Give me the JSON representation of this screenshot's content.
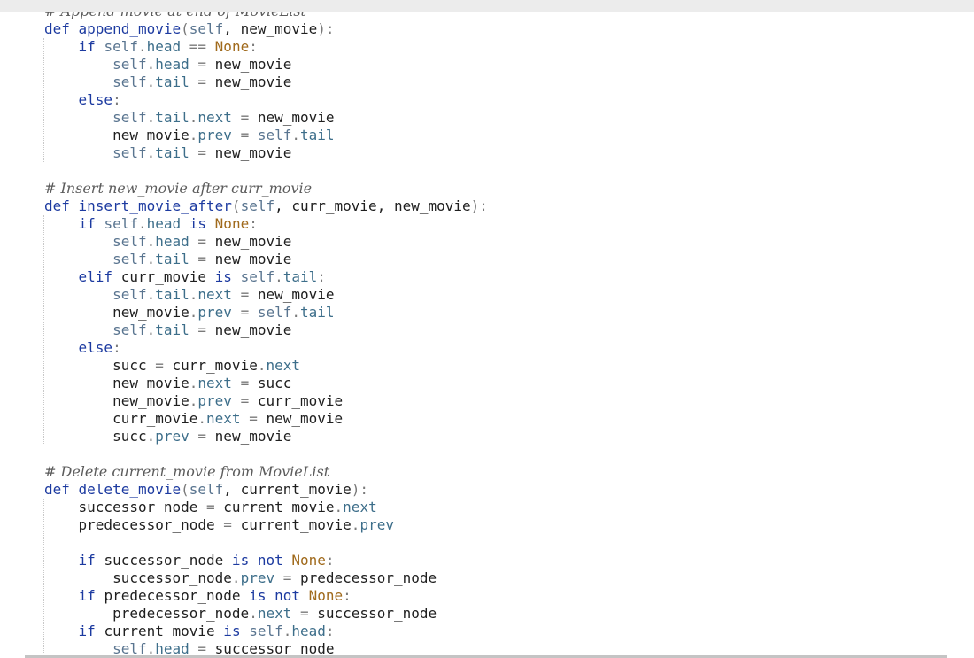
{
  "editor": {
    "lines": [
      [
        {
          "t": "# Append movie at end of MovieList",
          "c": "cm"
        }
      ],
      [
        {
          "t": "def ",
          "c": "kw"
        },
        {
          "t": "append_movie",
          "c": "kw"
        },
        {
          "t": "(",
          "c": "op"
        },
        {
          "t": "self",
          "c": "sf"
        },
        {
          "t": ", new_movie",
          "c": ""
        },
        {
          "t": "):",
          "c": "op"
        }
      ],
      [
        {
          "t": "    "
        },
        {
          "t": "if ",
          "c": "kw"
        },
        {
          "t": "self",
          "c": "sf"
        },
        {
          "t": ".",
          "c": "op"
        },
        {
          "t": "head",
          "c": "at"
        },
        {
          "t": " == ",
          "c": "op"
        },
        {
          "t": "None",
          "c": "bi"
        },
        {
          "t": ":",
          "c": "op"
        }
      ],
      [
        {
          "t": "        "
        },
        {
          "t": "self",
          "c": "sf"
        },
        {
          "t": ".",
          "c": "op"
        },
        {
          "t": "head",
          "c": "at"
        },
        {
          "t": " = ",
          "c": "op"
        },
        {
          "t": "new_movie"
        }
      ],
      [
        {
          "t": "        "
        },
        {
          "t": "self",
          "c": "sf"
        },
        {
          "t": ".",
          "c": "op"
        },
        {
          "t": "tail",
          "c": "at"
        },
        {
          "t": " = ",
          "c": "op"
        },
        {
          "t": "new_movie"
        }
      ],
      [
        {
          "t": "    "
        },
        {
          "t": "else",
          "c": "kw"
        },
        {
          "t": ":",
          "c": "op"
        }
      ],
      [
        {
          "t": "        "
        },
        {
          "t": "self",
          "c": "sf"
        },
        {
          "t": ".",
          "c": "op"
        },
        {
          "t": "tail",
          "c": "at"
        },
        {
          "t": ".",
          "c": "op"
        },
        {
          "t": "next",
          "c": "at"
        },
        {
          "t": " = ",
          "c": "op"
        },
        {
          "t": "new_movie"
        }
      ],
      [
        {
          "t": "        "
        },
        {
          "t": "new_movie"
        },
        {
          "t": ".",
          "c": "op"
        },
        {
          "t": "prev",
          "c": "at"
        },
        {
          "t": " = ",
          "c": "op"
        },
        {
          "t": "self",
          "c": "sf"
        },
        {
          "t": ".",
          "c": "op"
        },
        {
          "t": "tail",
          "c": "at"
        }
      ],
      [
        {
          "t": "        "
        },
        {
          "t": "self",
          "c": "sf"
        },
        {
          "t": ".",
          "c": "op"
        },
        {
          "t": "tail",
          "c": "at"
        },
        {
          "t": " = ",
          "c": "op"
        },
        {
          "t": "new_movie"
        }
      ],
      [],
      [
        {
          "t": "# Insert new_movie after curr_movie",
          "c": "cm"
        }
      ],
      [
        {
          "t": "def ",
          "c": "kw"
        },
        {
          "t": "insert_movie_after",
          "c": "kw"
        },
        {
          "t": "(",
          "c": "op"
        },
        {
          "t": "self",
          "c": "sf"
        },
        {
          "t": ", curr_movie, new_movie"
        },
        {
          "t": "):",
          "c": "op"
        }
      ],
      [
        {
          "t": "    "
        },
        {
          "t": "if ",
          "c": "kw"
        },
        {
          "t": "self",
          "c": "sf"
        },
        {
          "t": ".",
          "c": "op"
        },
        {
          "t": "head",
          "c": "at"
        },
        {
          "t": " is ",
          "c": "kw"
        },
        {
          "t": "None",
          "c": "bi"
        },
        {
          "t": ":",
          "c": "op"
        }
      ],
      [
        {
          "t": "        "
        },
        {
          "t": "self",
          "c": "sf"
        },
        {
          "t": ".",
          "c": "op"
        },
        {
          "t": "head",
          "c": "at"
        },
        {
          "t": " = ",
          "c": "op"
        },
        {
          "t": "new_movie"
        }
      ],
      [
        {
          "t": "        "
        },
        {
          "t": "self",
          "c": "sf"
        },
        {
          "t": ".",
          "c": "op"
        },
        {
          "t": "tail",
          "c": "at"
        },
        {
          "t": " = ",
          "c": "op"
        },
        {
          "t": "new_movie"
        }
      ],
      [
        {
          "t": "    "
        },
        {
          "t": "elif ",
          "c": "kw"
        },
        {
          "t": "curr_movie"
        },
        {
          "t": " is ",
          "c": "kw"
        },
        {
          "t": "self",
          "c": "sf"
        },
        {
          "t": ".",
          "c": "op"
        },
        {
          "t": "tail",
          "c": "at"
        },
        {
          "t": ":",
          "c": "op"
        }
      ],
      [
        {
          "t": "        "
        },
        {
          "t": "self",
          "c": "sf"
        },
        {
          "t": ".",
          "c": "op"
        },
        {
          "t": "tail",
          "c": "at"
        },
        {
          "t": ".",
          "c": "op"
        },
        {
          "t": "next",
          "c": "at"
        },
        {
          "t": " = ",
          "c": "op"
        },
        {
          "t": "new_movie"
        }
      ],
      [
        {
          "t": "        "
        },
        {
          "t": "new_movie"
        },
        {
          "t": ".",
          "c": "op"
        },
        {
          "t": "prev",
          "c": "at"
        },
        {
          "t": " = ",
          "c": "op"
        },
        {
          "t": "self",
          "c": "sf"
        },
        {
          "t": ".",
          "c": "op"
        },
        {
          "t": "tail",
          "c": "at"
        }
      ],
      [
        {
          "t": "        "
        },
        {
          "t": "self",
          "c": "sf"
        },
        {
          "t": ".",
          "c": "op"
        },
        {
          "t": "tail",
          "c": "at"
        },
        {
          "t": " = ",
          "c": "op"
        },
        {
          "t": "new_movie"
        }
      ],
      [
        {
          "t": "    "
        },
        {
          "t": "else",
          "c": "kw"
        },
        {
          "t": ":",
          "c": "op"
        }
      ],
      [
        {
          "t": "        "
        },
        {
          "t": "succ"
        },
        {
          "t": " = ",
          "c": "op"
        },
        {
          "t": "curr_movie"
        },
        {
          "t": ".",
          "c": "op"
        },
        {
          "t": "next",
          "c": "at"
        }
      ],
      [
        {
          "t": "        "
        },
        {
          "t": "new_movie"
        },
        {
          "t": ".",
          "c": "op"
        },
        {
          "t": "next",
          "c": "at"
        },
        {
          "t": " = ",
          "c": "op"
        },
        {
          "t": "succ"
        }
      ],
      [
        {
          "t": "        "
        },
        {
          "t": "new_movie"
        },
        {
          "t": ".",
          "c": "op"
        },
        {
          "t": "prev",
          "c": "at"
        },
        {
          "t": " = ",
          "c": "op"
        },
        {
          "t": "curr_movie"
        }
      ],
      [
        {
          "t": "        "
        },
        {
          "t": "curr_movie"
        },
        {
          "t": ".",
          "c": "op"
        },
        {
          "t": "next",
          "c": "at"
        },
        {
          "t": " = ",
          "c": "op"
        },
        {
          "t": "new_movie"
        }
      ],
      [
        {
          "t": "        "
        },
        {
          "t": "succ"
        },
        {
          "t": ".",
          "c": "op"
        },
        {
          "t": "prev",
          "c": "at"
        },
        {
          "t": " = ",
          "c": "op"
        },
        {
          "t": "new_movie"
        }
      ],
      [],
      [
        {
          "t": "# Delete current_movie from MovieList",
          "c": "cm"
        }
      ],
      [
        {
          "t": "def ",
          "c": "kw"
        },
        {
          "t": "delete_movie",
          "c": "kw"
        },
        {
          "t": "(",
          "c": "op"
        },
        {
          "t": "self",
          "c": "sf"
        },
        {
          "t": ", current_movie"
        },
        {
          "t": "):",
          "c": "op"
        }
      ],
      [
        {
          "t": "    "
        },
        {
          "t": "successor_node"
        },
        {
          "t": " = ",
          "c": "op"
        },
        {
          "t": "current_movie"
        },
        {
          "t": ".",
          "c": "op"
        },
        {
          "t": "next",
          "c": "at"
        }
      ],
      [
        {
          "t": "    "
        },
        {
          "t": "predecessor_node"
        },
        {
          "t": " = ",
          "c": "op"
        },
        {
          "t": "current_movie"
        },
        {
          "t": ".",
          "c": "op"
        },
        {
          "t": "prev",
          "c": "at"
        }
      ],
      [],
      [
        {
          "t": "    "
        },
        {
          "t": "if ",
          "c": "kw"
        },
        {
          "t": "successor_node"
        },
        {
          "t": " is not ",
          "c": "kw"
        },
        {
          "t": "None",
          "c": "bi"
        },
        {
          "t": ":",
          "c": "op"
        }
      ],
      [
        {
          "t": "        "
        },
        {
          "t": "successor_node"
        },
        {
          "t": ".",
          "c": "op"
        },
        {
          "t": "prev",
          "c": "at"
        },
        {
          "t": " = ",
          "c": "op"
        },
        {
          "t": "predecessor_node"
        }
      ],
      [
        {
          "t": "    "
        },
        {
          "t": "if ",
          "c": "kw"
        },
        {
          "t": "predecessor_node"
        },
        {
          "t": " is not ",
          "c": "kw"
        },
        {
          "t": "None",
          "c": "bi"
        },
        {
          "t": ":",
          "c": "op"
        }
      ],
      [
        {
          "t": "        "
        },
        {
          "t": "predecessor_node"
        },
        {
          "t": ".",
          "c": "op"
        },
        {
          "t": "next",
          "c": "at"
        },
        {
          "t": " = ",
          "c": "op"
        },
        {
          "t": "successor_node"
        }
      ],
      [
        {
          "t": "    "
        },
        {
          "t": "if ",
          "c": "kw"
        },
        {
          "t": "current_movie"
        },
        {
          "t": " is ",
          "c": "kw"
        },
        {
          "t": "self",
          "c": "sf"
        },
        {
          "t": ".",
          "c": "op"
        },
        {
          "t": "head",
          "c": "at"
        },
        {
          "t": ":",
          "c": "op"
        }
      ],
      [
        {
          "t": "        "
        },
        {
          "t": "self",
          "c": "sf"
        },
        {
          "t": ".",
          "c": "op"
        },
        {
          "t": "head",
          "c": "at"
        },
        {
          "t": " = ",
          "c": "op"
        },
        {
          "t": "successor_node"
        }
      ]
    ]
  },
  "colors": {
    "keyword": "#1c3aa0",
    "self": "#5a7590",
    "builtin": "#a06a1c",
    "attribute": "#3d6e8a",
    "comment": "#5c5c5c",
    "text": "#1f1f1f"
  }
}
